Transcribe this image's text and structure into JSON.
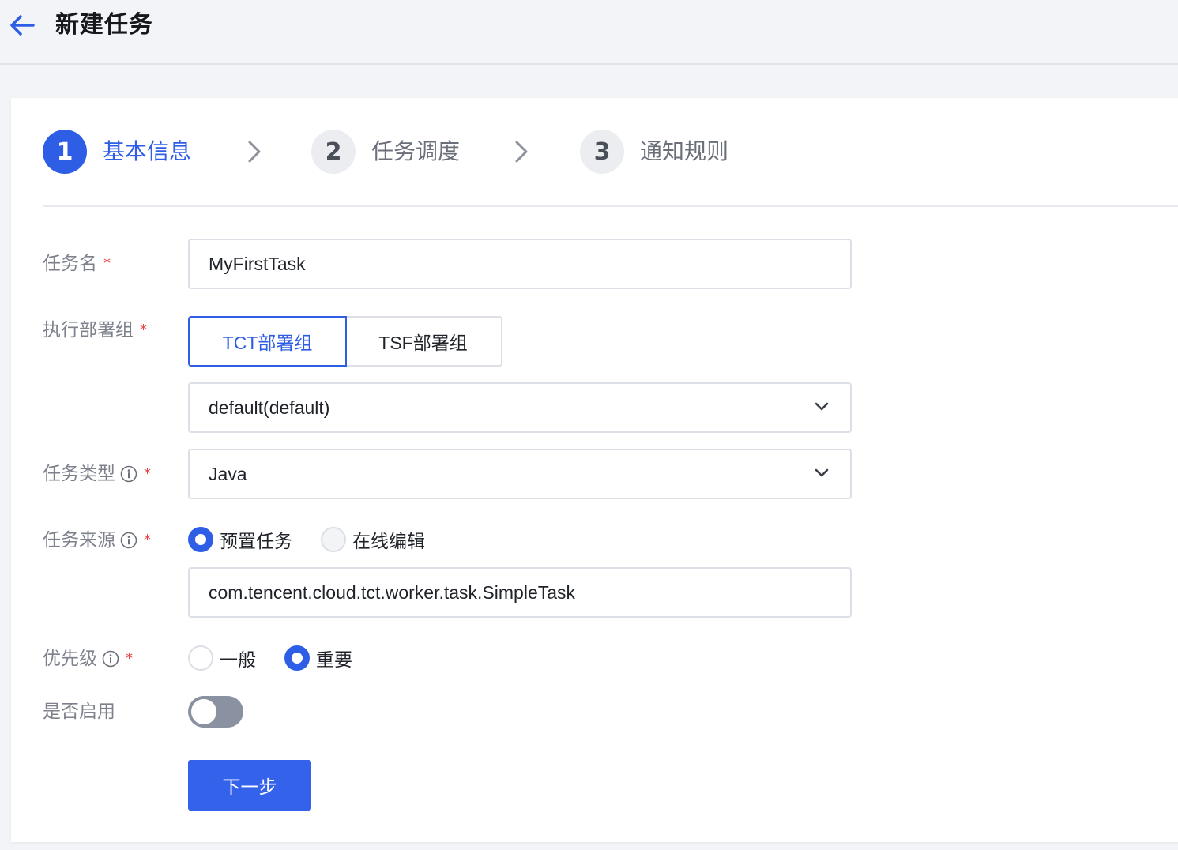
{
  "header": {
    "title": "新建任务"
  },
  "steps": [
    {
      "number": "1",
      "label": "基本信息",
      "state": "active"
    },
    {
      "number": "2",
      "label": "任务调度",
      "state": "inactive"
    },
    {
      "number": "3",
      "label": "通知规则",
      "state": "inactive"
    }
  ],
  "form": {
    "task_name": {
      "label": "任务名",
      "value": "MyFirstTask"
    },
    "deploy_group": {
      "label": "执行部署组",
      "options": [
        "TCT部署组",
        "TSF部署组"
      ],
      "selected": "TCT部署组",
      "select_value": "default(default)"
    },
    "task_type": {
      "label": "任务类型",
      "value": "Java"
    },
    "task_source": {
      "label": "任务来源",
      "options": [
        "预置任务",
        "在线编辑"
      ],
      "selected": "预置任务",
      "value": "com.tencent.cloud.tct.worker.task.SimpleTask"
    },
    "priority": {
      "label": "优先级",
      "options": [
        "一般",
        "重要"
      ],
      "selected": "重要"
    },
    "enabled": {
      "label": "是否启用",
      "value": false
    },
    "required_mark": "*"
  },
  "actions": {
    "next_label": "下一步"
  },
  "colors": {
    "accent": "#2f5ee6",
    "required": "#e54545",
    "toggle_off": "#8a92a1"
  }
}
